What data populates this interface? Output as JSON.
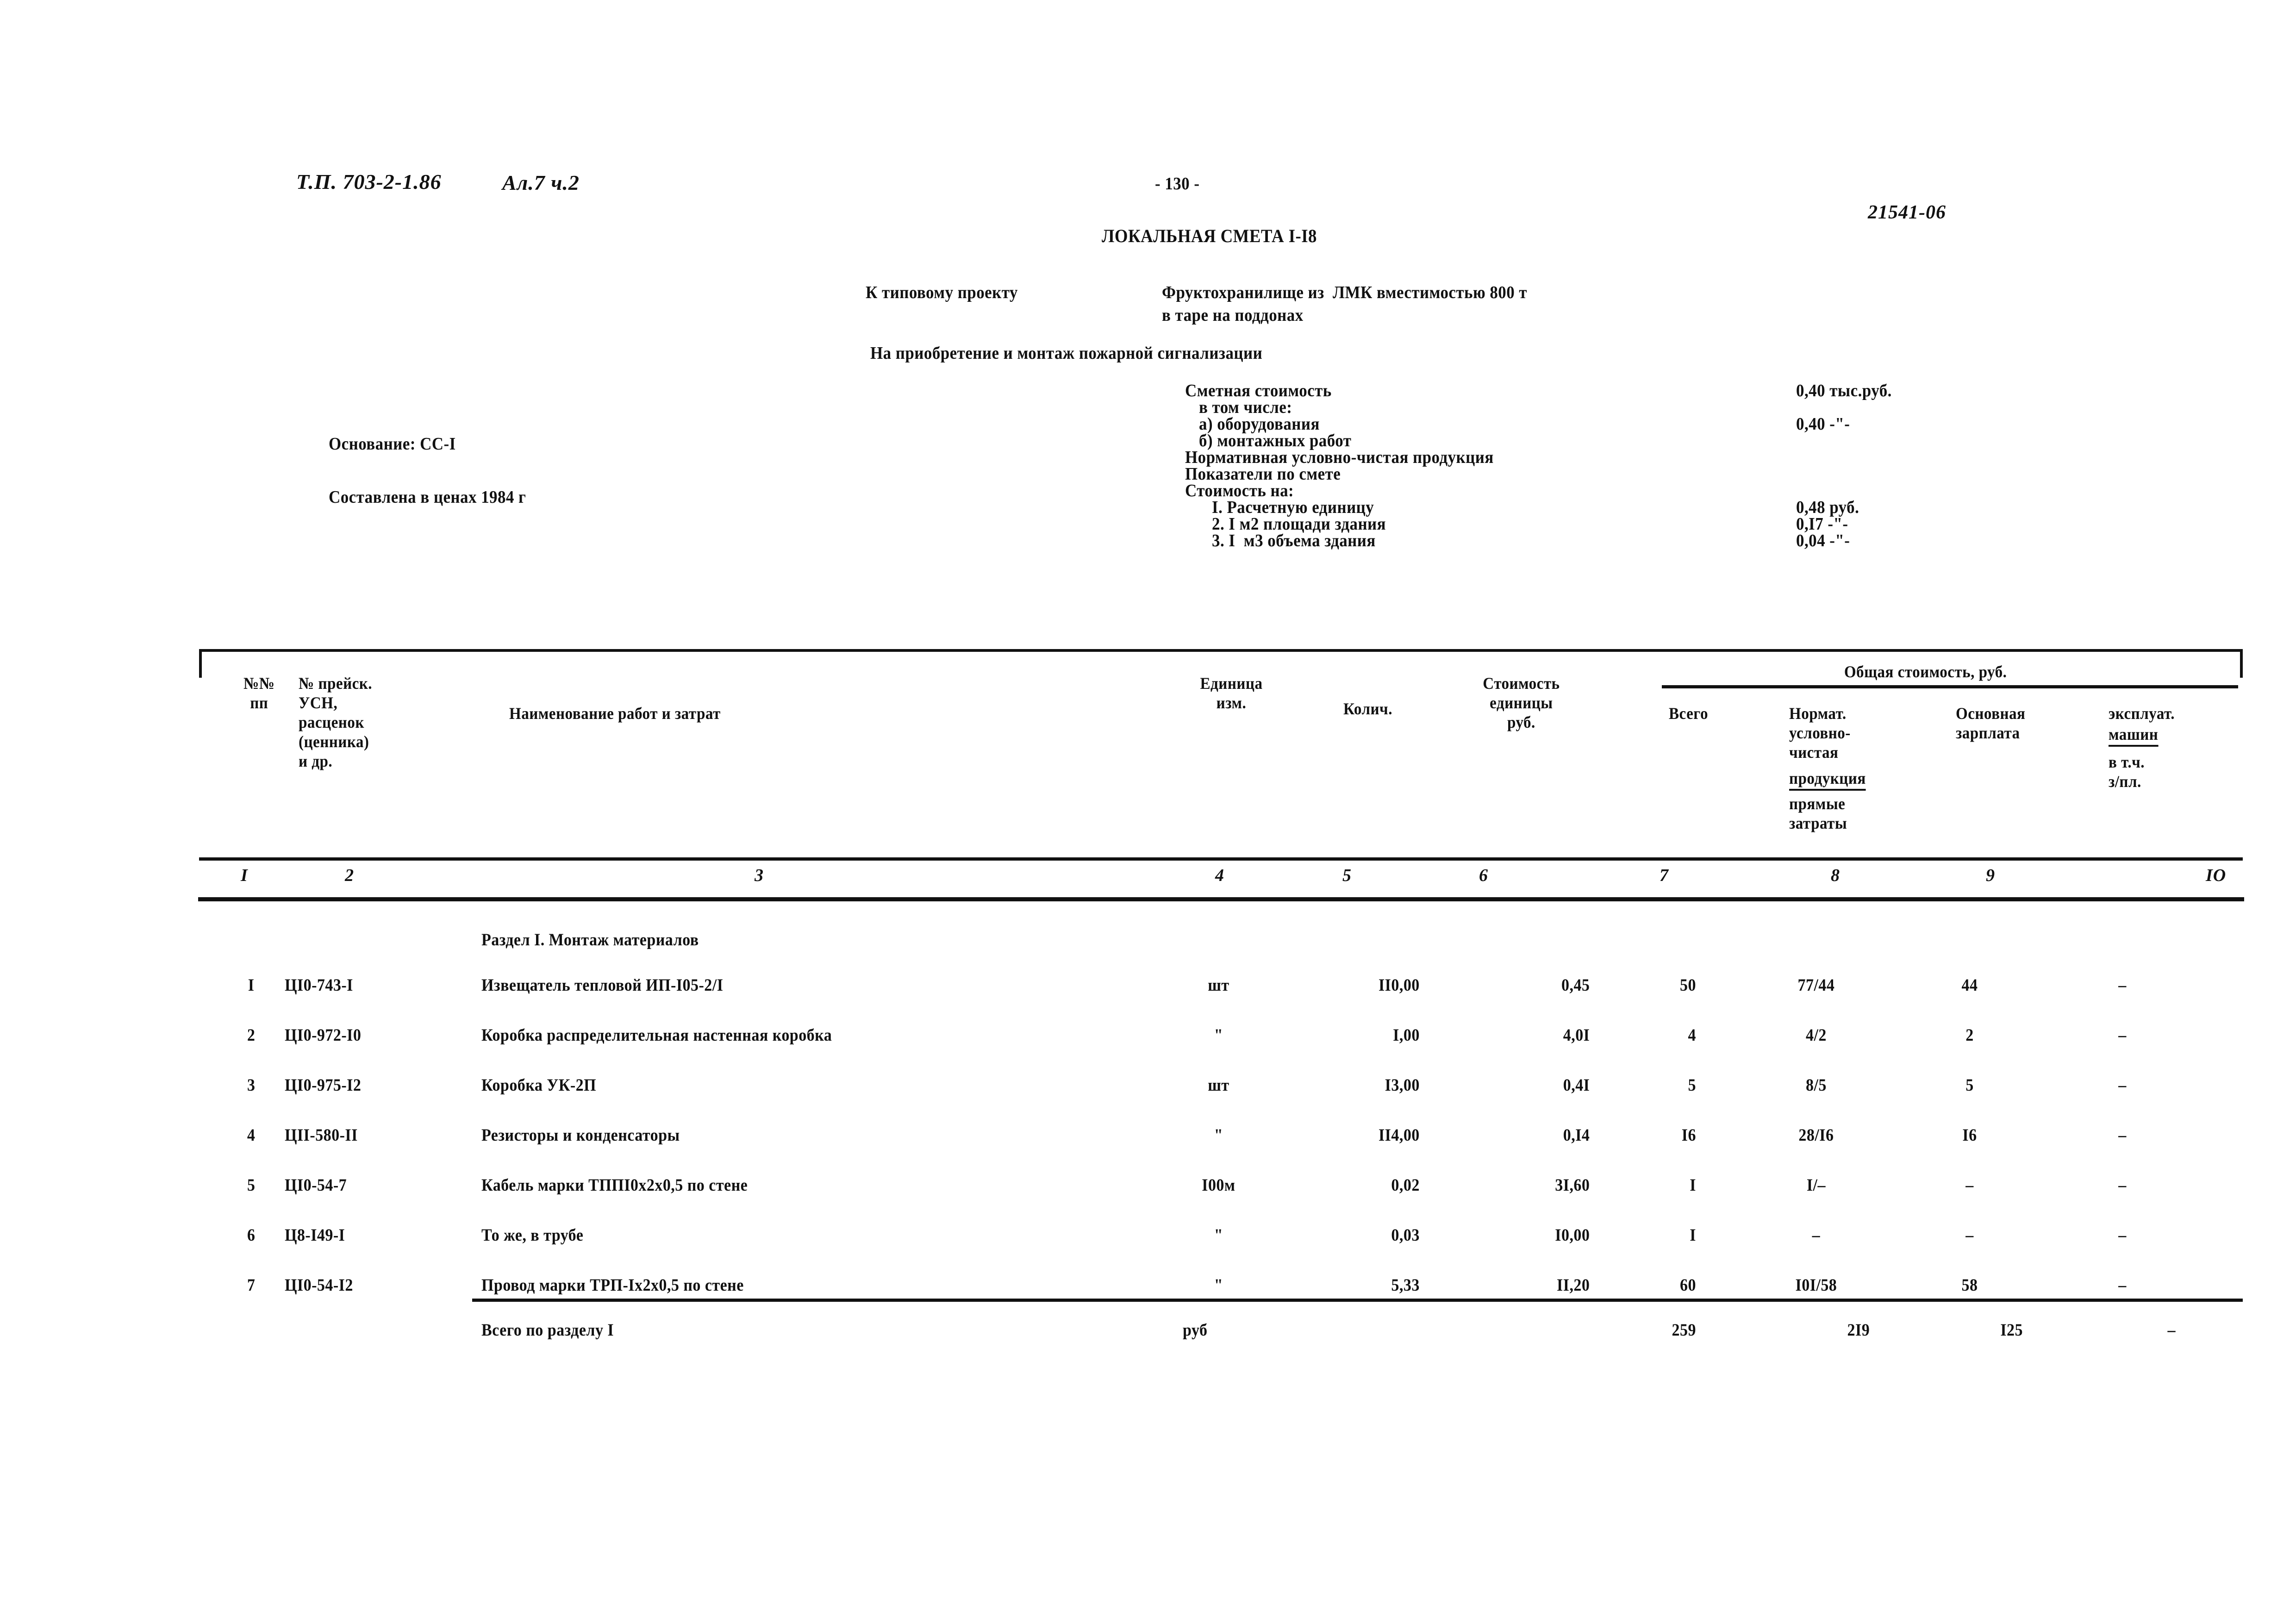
{
  "header": {
    "project_code": "Т.П. 703-2-1.86",
    "album": "Ал.7 ч.2",
    "page_number": "- 130 -",
    "doc_code": "21541-06"
  },
  "title": {
    "main": "ЛОКАЛЬНАЯ СМЕТА I-I8",
    "subject_label": "К типовому проекту",
    "subject_value": "Фруктохранилище из  ЛМК вместимостью 800 т",
    "subject_value_line2": "в таре на поддонах",
    "purpose": "На приобретение и монтаж пожарной сигнализации"
  },
  "basis": {
    "basis_label": "Основание: СС-I",
    "prices_label": "Составлена в ценах 1984 г"
  },
  "summary": {
    "rows": [
      {
        "label": "Сметная стоимость",
        "value": "0,40 тыс.руб.",
        "indent": 0
      },
      {
        "label": "в том числе:",
        "value": "",
        "indent": 1
      },
      {
        "label": "а) оборудования",
        "value": "0,40 -\"-",
        "indent": 1
      },
      {
        "label": "б) монтажных работ",
        "value": "",
        "indent": 1
      },
      {
        "label": "Нормативная условно-чистая продукция",
        "value": "",
        "indent": 0
      },
      {
        "label": "Показатели по смете",
        "value": "",
        "indent": 0
      },
      {
        "label": "Стоимость на:",
        "value": "",
        "indent": 0
      },
      {
        "label": "I. Расчетную единицу",
        "value": "0,48 руб.",
        "indent": 2
      },
      {
        "label": "2. I м2 площади здания",
        "value": "0,I7 -\"-",
        "indent": 2
      },
      {
        "label": "3. I  м3 объема здания",
        "value": "0,04 -\"-",
        "indent": 2
      }
    ]
  },
  "table": {
    "col_group_label": "Общая стоимость, руб.",
    "headers": {
      "c1": "№№\nпп",
      "c2": "№ прейск.\nУСН,\nрасценок\n(ценника)\nи др.",
      "c3": "Наименование работ и затрат",
      "c4": "Единица\nизм.",
      "c5": "Колич.",
      "c6": "Стоимость\nединицы\nруб.",
      "c7": "Всего",
      "c8_a": "Нормат.\nусловно-\nчистая",
      "c8_b": "продукция",
      "c8_c": "прямые\nзатраты",
      "c9": "Основная\nзарплата",
      "c10_a": "эксплуат.",
      "c10_b": "машин",
      "c10_c": "в т.ч.\nз/пл."
    },
    "column_numbers": [
      "I",
      "2",
      "3",
      "4",
      "5",
      "6",
      "7",
      "8",
      "9",
      "IO"
    ],
    "section_title": "Раздел I. Монтаж материалов",
    "rows": [
      {
        "num": "I",
        "code": "ЦI0-743-I",
        "name": "Извещатель тепловой ИП-I05-2/I",
        "unit": "шт",
        "qty": "II0,00",
        "unit_cost": "0,45",
        "total": "50",
        "nuchp": "77/44",
        "salary": "44",
        "machines": "–"
      },
      {
        "num": "2",
        "code": "ЦI0-972-I0",
        "name": "Коробка распределительная настенная коробка",
        "unit": "\"",
        "qty": "I,00",
        "unit_cost": "4,0I",
        "total": "4",
        "nuchp": "4/2",
        "salary": "2",
        "machines": "–"
      },
      {
        "num": "3",
        "code": "ЦI0-975-I2",
        "name": "Коробка УК-2П",
        "unit": "шт",
        "qty": "I3,00",
        "unit_cost": "0,4I",
        "total": "5",
        "nuchp": "8/5",
        "salary": "5",
        "machines": "–"
      },
      {
        "num": "4",
        "code": "ЦII-580-II",
        "name": "Резисторы и конденсаторы",
        "unit": "\"",
        "qty": "II4,00",
        "unit_cost": "0,I4",
        "total": "I6",
        "nuchp": "28/I6",
        "salary": "I6",
        "machines": "–"
      },
      {
        "num": "5",
        "code": "ЦI0-54-7",
        "name": "Кабель марки ТППI0х2х0,5 по стене",
        "unit": "I00м",
        "qty": "0,02",
        "unit_cost": "3I,60",
        "total": "I",
        "nuchp": "I/–",
        "salary": "–",
        "machines": "–"
      },
      {
        "num": "6",
        "code": "Ц8-I49-I",
        "name": "То же, в трубе",
        "unit": "\"",
        "qty": "0,03",
        "unit_cost": "I0,00",
        "total": "I",
        "nuchp": "–",
        "salary": "–",
        "machines": "–"
      },
      {
        "num": "7",
        "code": "ЦI0-54-I2",
        "name": "Провод марки ТРП-Iх2х0,5 по стене",
        "unit": "\"",
        "qty": "5,33",
        "unit_cost": "II,20",
        "total": "60",
        "nuchp": "I0I/58",
        "salary": "58",
        "machines": "–"
      }
    ],
    "total_row": {
      "name": "Всего по разделу I",
      "unit": "руб",
      "total": "259",
      "nuchp": "2I9",
      "salary": "I25",
      "machines": "–"
    }
  }
}
